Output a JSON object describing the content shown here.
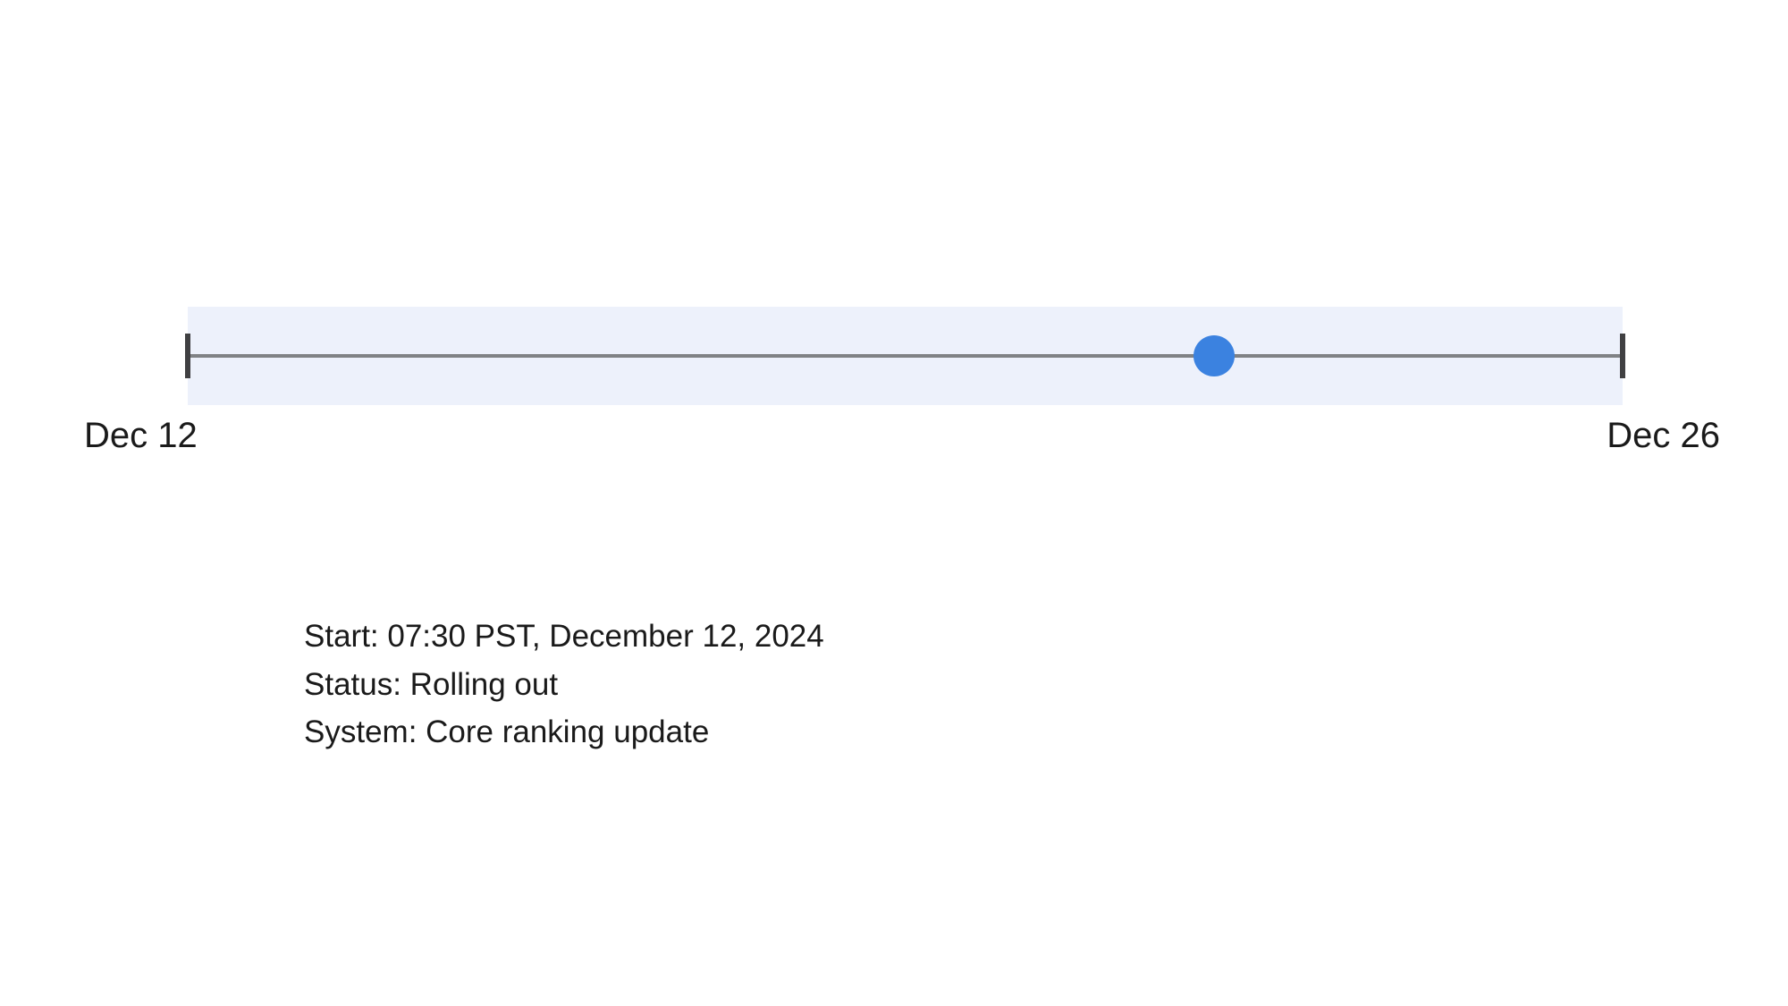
{
  "timeline": {
    "start_label": "Dec 12",
    "end_label": "Dec 26",
    "marker_position_percent": 71.5
  },
  "details": {
    "start": "Start: 07:30 PST, December 12, 2024",
    "status": "Status: Rolling out",
    "system": "System: Core ranking update"
  }
}
